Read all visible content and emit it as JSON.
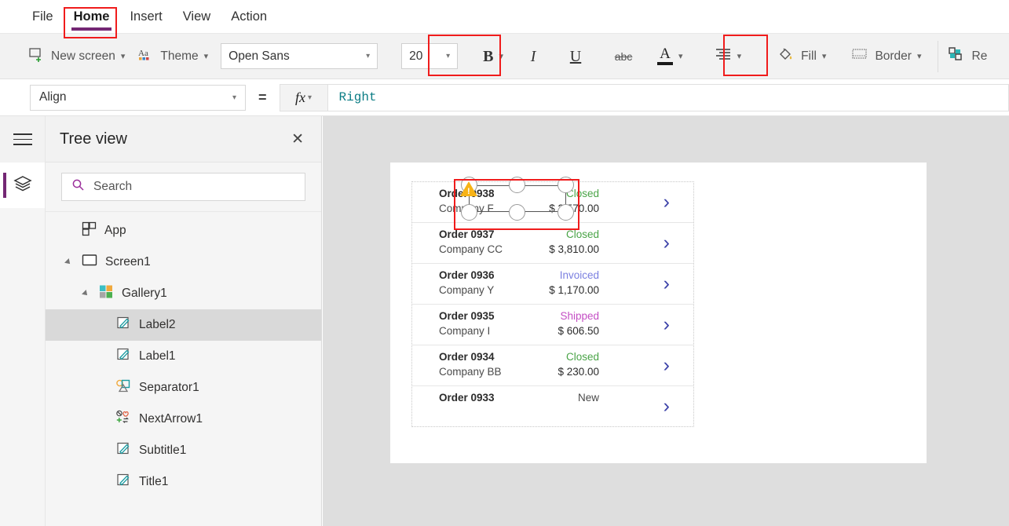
{
  "menu": {
    "items": [
      {
        "label": "File",
        "active": false
      },
      {
        "label": "Home",
        "active": true
      },
      {
        "label": "Insert",
        "active": false
      },
      {
        "label": "View",
        "active": false
      },
      {
        "label": "Action",
        "active": false
      }
    ]
  },
  "ribbon": {
    "new_screen_label": "New screen",
    "theme_label": "Theme",
    "font_family_value": "Open Sans",
    "font_size_value": "20",
    "bold_label": "B",
    "italic_label": "I",
    "underline_label": "U",
    "strikethrough_label": "abc",
    "font_color_label": "A",
    "fill_label": "Fill",
    "border_label": "Border",
    "reorder_label": "Re",
    "icons": {
      "new_screen": "new-screen-icon",
      "theme": "theme-icon",
      "align": "align-icon",
      "fill": "paint-bucket-icon",
      "border": "border-icon",
      "reorder": "reorder-icon"
    }
  },
  "formula_bar": {
    "property_value": "Align",
    "equals": "=",
    "fx_label": "fx",
    "expression": "Right"
  },
  "left_rail": {
    "hamburger": "hamburger-menu-icon",
    "tree_view_icon": "layers-icon"
  },
  "tree_panel": {
    "title": "Tree view",
    "close_label": "✕",
    "search_placeholder": "Search",
    "search_value": "",
    "nodes": [
      {
        "label": "App",
        "icon": "app-icon",
        "indent": 0,
        "caret": false,
        "selected": false
      },
      {
        "label": "Screen1",
        "icon": "screen-icon",
        "indent": 0,
        "caret": true,
        "selected": false
      },
      {
        "label": "Gallery1",
        "icon": "gallery-icon",
        "indent": 1,
        "caret": true,
        "selected": false
      },
      {
        "label": "Label2",
        "icon": "label-icon",
        "indent": 2,
        "caret": false,
        "selected": true
      },
      {
        "label": "Label1",
        "icon": "label-icon",
        "indent": 2,
        "caret": false,
        "selected": false
      },
      {
        "label": "Separator1",
        "icon": "separator-icon",
        "indent": 2,
        "caret": false,
        "selected": false
      },
      {
        "label": "NextArrow1",
        "icon": "next-arrow-icon",
        "indent": 2,
        "caret": false,
        "selected": false
      },
      {
        "label": "Subtitle1",
        "icon": "label-icon",
        "indent": 2,
        "caret": false,
        "selected": false
      },
      {
        "label": "Title1",
        "icon": "label-icon",
        "indent": 2,
        "caret": false,
        "selected": false
      }
    ]
  },
  "canvas": {
    "gallery": {
      "rows": [
        {
          "title": "Order 0938",
          "subtitle": "Company F",
          "status": "Closed",
          "status_color": "#4aa447",
          "amount": "$ 2,570.00",
          "arrow": "›"
        },
        {
          "title": "Order 0937",
          "subtitle": "Company CC",
          "status": "Closed",
          "status_color": "#4aa447",
          "amount": "$ 3,810.00",
          "arrow": "›"
        },
        {
          "title": "Order 0936",
          "subtitle": "Company Y",
          "status": "Invoiced",
          "status_color": "#7a7fe0",
          "amount": "$ 1,170.00",
          "arrow": "›"
        },
        {
          "title": "Order 0935",
          "subtitle": "Company I",
          "status": "Shipped",
          "status_color": "#c44ec4",
          "amount": "$ 606.50",
          "arrow": "›"
        },
        {
          "title": "Order 0934",
          "subtitle": "Company BB",
          "status": "Closed",
          "status_color": "#4aa447",
          "amount": "$ 230.00",
          "arrow": "›"
        },
        {
          "title": "Order 0933",
          "subtitle": "",
          "status": "New",
          "status_color": "#4a4a4a",
          "amount": "",
          "arrow": "›"
        }
      ]
    },
    "selection": {
      "warning_glyph": "!",
      "handle_count": 6
    }
  },
  "annotations": {
    "colors": {
      "highlight": "#f01c1c",
      "accent": "#742774"
    },
    "boxes": [
      "home-tab",
      "font-size-combo",
      "align-button",
      "selected-label"
    ]
  }
}
